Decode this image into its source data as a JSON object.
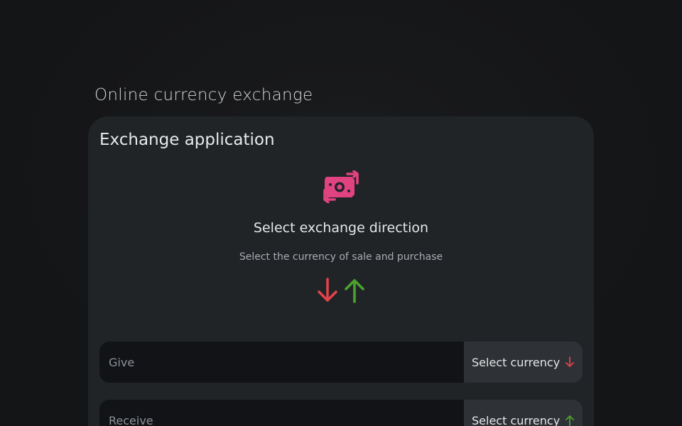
{
  "page": {
    "title": "Online currency exchange"
  },
  "card": {
    "title": "Exchange application",
    "icon": "money-exchange-icon",
    "direction_title": "Select exchange direction",
    "direction_subtitle": "Select the currency of sale and purchase",
    "arrow_icons": [
      "arrow-down-icon",
      "arrow-up-icon"
    ]
  },
  "give": {
    "placeholder": "Give",
    "value": "",
    "select_label": "Select currency",
    "select_icon": "arrow-down-icon"
  },
  "receive": {
    "placeholder": "Receive",
    "value": "",
    "select_label": "Select currency",
    "select_icon": "arrow-up-icon"
  },
  "colors": {
    "background": "#151618",
    "card": "#212427",
    "accent_pink": "#e0437f",
    "sell_red": "#e0434b",
    "buy_green": "#4aa32e"
  }
}
